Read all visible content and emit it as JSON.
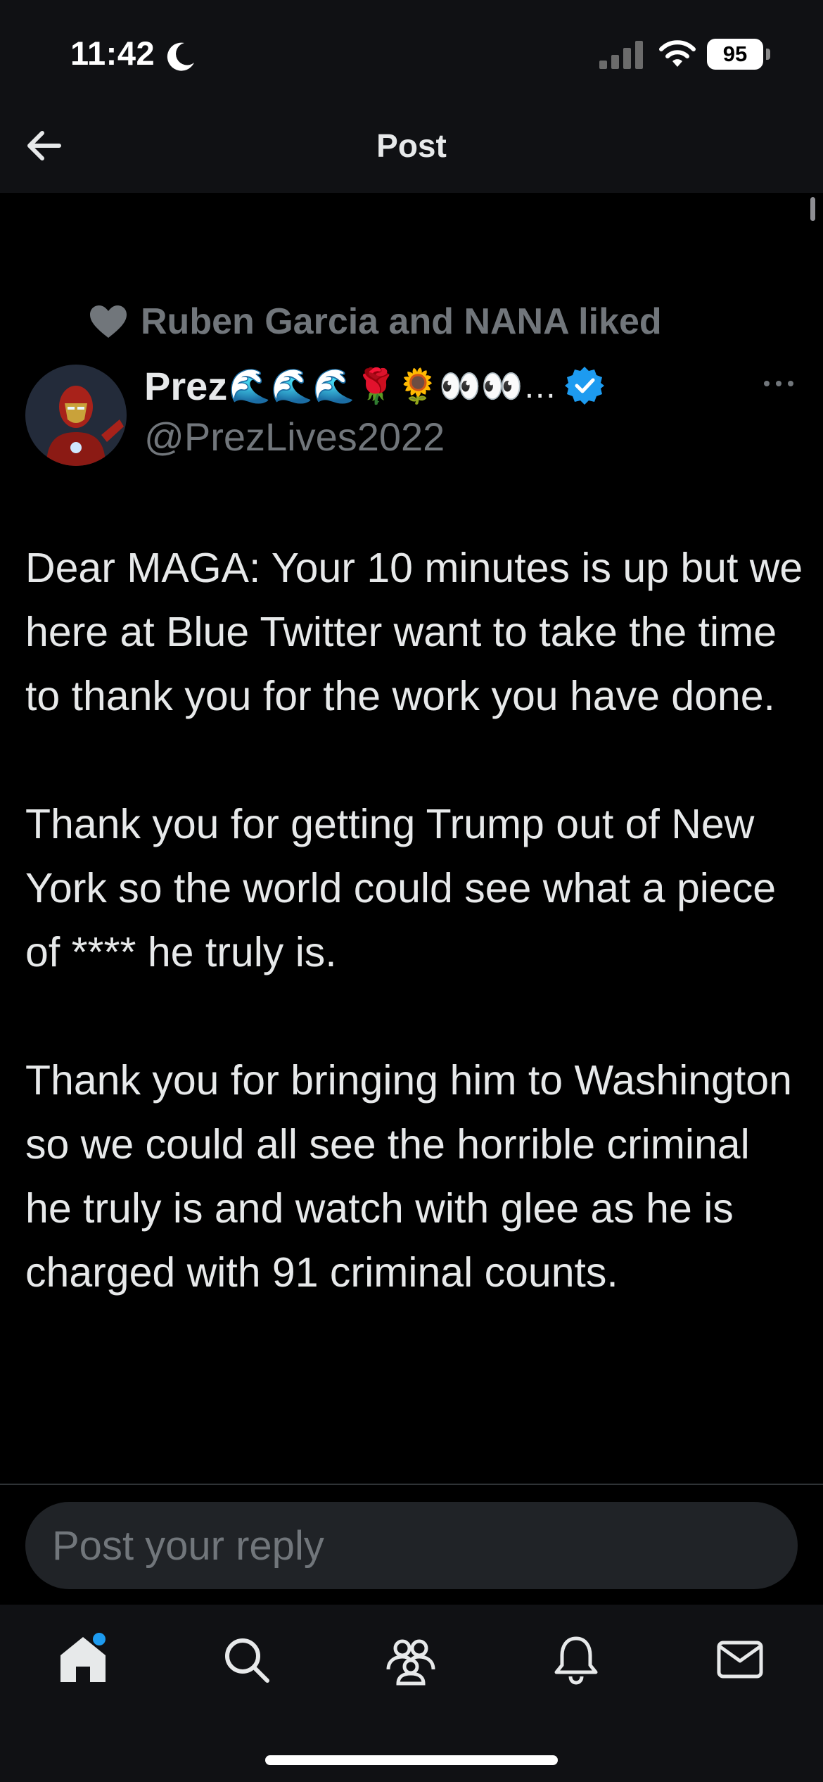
{
  "status_bar": {
    "time": "11:42",
    "battery": "95"
  },
  "header": {
    "title": "Post"
  },
  "post": {
    "social_context": "Ruben Garcia and NANA liked",
    "author": {
      "name": "Prez",
      "name_emoji": "🌊🌊🌊🌹🌻👀👀…",
      "handle": "@PrezLives2022",
      "verified": true
    },
    "body": [
      "Dear MAGA: Your 10 minutes is up but we here at Blue Twitter want to take the time to thank you for the work you have done.",
      "Thank you for getting Trump out of New York so the world could see what a piece of **** he truly is.",
      "Thank you for bringing him to Washington so we could all see the horrible criminal he truly is and watch with glee as he is charged with 91 criminal counts."
    ]
  },
  "reply": {
    "placeholder": "Post your reply"
  },
  "tab_bar": {
    "items": [
      {
        "icon": "home-icon",
        "active": true,
        "has_badge": true
      },
      {
        "icon": "search-icon"
      },
      {
        "icon": "communities-icon"
      },
      {
        "icon": "bell-icon"
      },
      {
        "icon": "mail-icon"
      }
    ]
  },
  "colors": {
    "accent": "#1d9bf0",
    "secondary_text": "#71767b",
    "background": "#000000"
  }
}
